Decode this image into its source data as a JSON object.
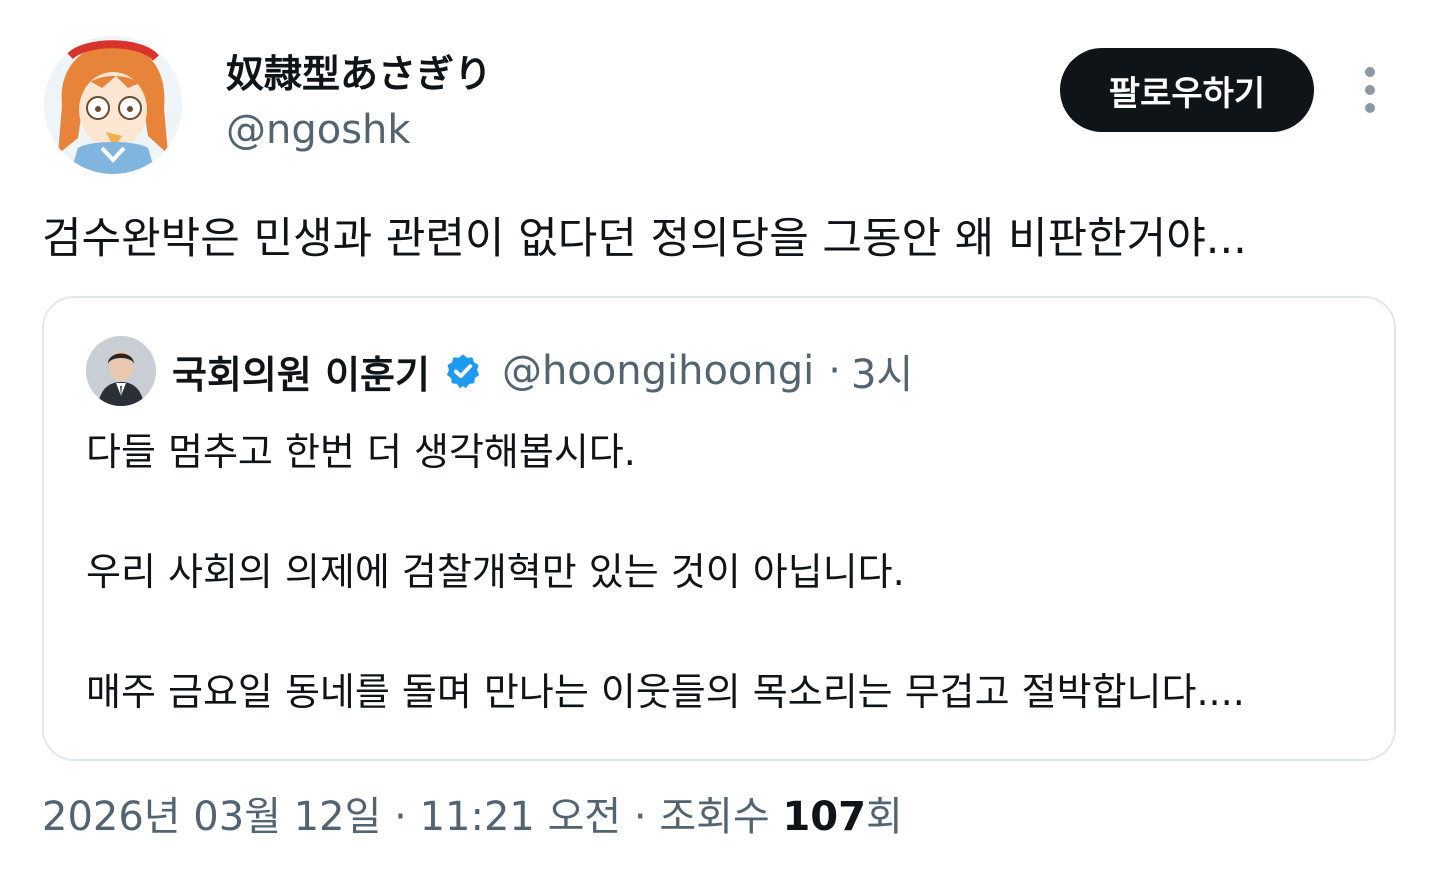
{
  "author": {
    "display_name": "奴隷型あさぎり",
    "handle": "@ngoshk",
    "avatar_icon": "anime-character-avatar"
  },
  "actions": {
    "follow_label": "팔로우하기",
    "more_icon": "more-vertical-icon"
  },
  "tweet": {
    "text": "검수완박은 민생과 관련이 없다던 정의당을 그동안 왜 비판한거야..."
  },
  "quote": {
    "name": "국회의원 이훈기",
    "verified_icon": "verified-badge-icon",
    "verified_color": "#1d9bf0",
    "handle": "@hoongihoongi",
    "separator": "·",
    "time": "3시",
    "lines": [
      "다들 멈추고 한번 더 생각해봅시다.",
      "우리 사회의 의제에 검찰개혁만 있는 것이 아닙니다.",
      "매주 금요일 동네를 돌며 만나는 이웃들의 목소리는 무겁고 절박합니다...."
    ]
  },
  "meta": {
    "date": "2026년 03월 12일",
    "sep1": "·",
    "time": "11:21 오전",
    "sep2": "·",
    "views_label": "조회수",
    "views_count": "107",
    "views_suffix": "회"
  },
  "colors": {
    "text_primary": "#0f1419",
    "text_secondary": "#536471",
    "border": "#e1e8ed",
    "button_bg": "#0f1419",
    "button_text": "#ffffff"
  }
}
